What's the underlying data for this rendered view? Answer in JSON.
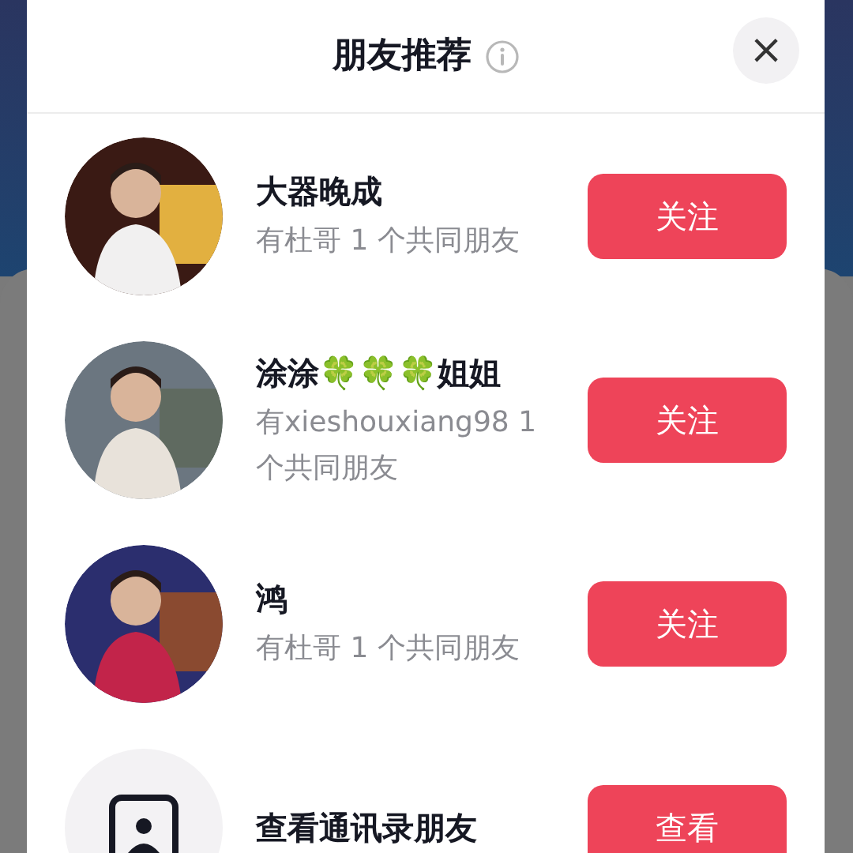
{
  "dialog": {
    "title": "朋友推荐",
    "close": "×"
  },
  "rows": [
    {
      "kind": "person",
      "name": "大器晚成",
      "subtitle": "有杜哥 1 个共同朋友",
      "button": "关注"
    },
    {
      "kind": "person",
      "name": "涂涂🍀🍀🍀姐姐",
      "subtitle": "有xieshouxiang98 1 个共同朋友",
      "button": "关注"
    },
    {
      "kind": "person",
      "name": "鸿",
      "subtitle": "有杜哥 1 个共同朋友",
      "button": "关注"
    },
    {
      "kind": "contacts",
      "name": "查看通讯录朋友",
      "button": "查看"
    }
  ]
}
